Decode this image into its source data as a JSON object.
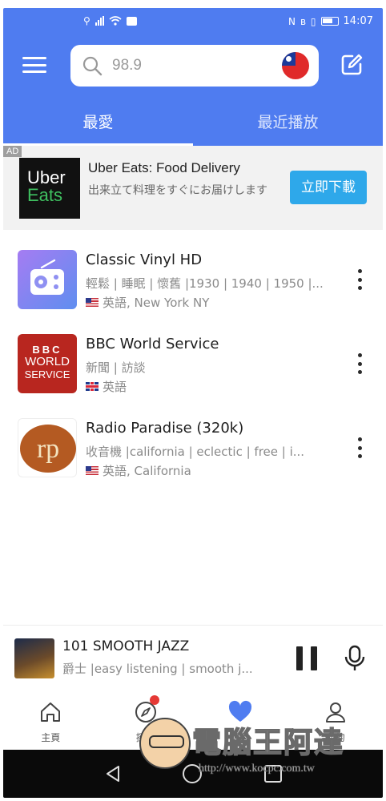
{
  "status_bar": {
    "time": "14:07"
  },
  "header": {
    "search_query": "98.9",
    "tabs": [
      {
        "label": "最愛",
        "active": true
      },
      {
        "label": "最近播放",
        "active": false
      }
    ]
  },
  "ad": {
    "tag": "AD",
    "logo_line1": "Uber",
    "logo_line2": "Eats",
    "title": "Uber Eats: Food Delivery",
    "description": "出来立て料理をすぐにお届けします",
    "cta": "立即下載"
  },
  "stations": [
    {
      "name": "Classic Vinyl HD",
      "tags": "輕鬆 | 睡眠 | 懷舊 |1930 | 1940 | 1950 |...",
      "location": "英語, New York NY",
      "flag": "us",
      "logo": "radio-icon"
    },
    {
      "name": "BBC World Service",
      "tags": "新聞 | 訪談",
      "location": "英語",
      "flag": "uk",
      "logo_lines": [
        "BBC",
        "WORLD",
        "SERVICE"
      ]
    },
    {
      "name": "Radio Paradise (320k)",
      "tags": "收音機 |california | eclectic | free | i...",
      "location": "英語, California",
      "flag": "us",
      "logo_text": "rp"
    }
  ],
  "now_playing": {
    "title": "101 SMOOTH JAZZ",
    "tags": "爵士 |easy listening | smooth j..."
  },
  "bottom_nav": [
    {
      "label": "主頁",
      "icon": "home-icon"
    },
    {
      "label": "探索",
      "icon": "compass-icon",
      "badge": true
    },
    {
      "label": "最愛",
      "icon": "heart-icon",
      "active": true
    },
    {
      "label": "我的",
      "icon": "user-icon"
    }
  ],
  "watermark": {
    "text": "電腦王阿達",
    "url": "http://www.kocpc.com.tw"
  },
  "colors": {
    "primary": "#4f7cf0",
    "accent_button": "#2ea8ea",
    "badge_red": "#e53935",
    "bbc_red": "#b8261f"
  }
}
